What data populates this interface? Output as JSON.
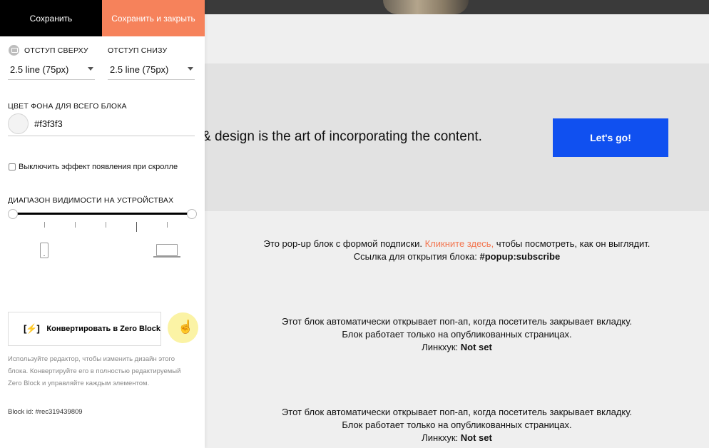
{
  "toolbar": {
    "save_label": "Сохранить",
    "save_close_label": "Сохранить и закрыть"
  },
  "settings": {
    "padding_top": {
      "label": "ОТСТУП СВЕРХУ",
      "value": "2.5 line (75px)",
      "icon": "monitor-icon"
    },
    "padding_bottom": {
      "label": "ОТСТУП СНИЗУ",
      "value": "2.5 line (75px)"
    },
    "bg_color": {
      "label": "ЦВЕТ ФОНА ДЛЯ ВСЕГО БЛОКА",
      "value": "#f3f3f3",
      "swatch": "#f3f3f3"
    },
    "disable_scroll_effect": {
      "label": "Выключить эффект появления при скролле",
      "checked": false
    },
    "visibility": {
      "label": "ДИАПАЗОН ВИДИМОСТИ НА УСТРОЙСТВАХ",
      "min_icon": "phone-icon",
      "max_icon": "laptop-icon"
    },
    "zero_block": {
      "button_label": "Конвертировать в Zero Block",
      "icon": "[⚡]",
      "help": "Используйте редактор, чтобы изменить дизайн этого блока. Конвертируйте его в полностью редактируемый Zero Block и управляйте каждым элементом."
    },
    "block_id": "Block id: #rec319439809"
  },
  "canvas": {
    "cta_text": "& design is the art of incorporating the content.",
    "cta_button": "Let's go!",
    "popup_info": {
      "line1_pre": "Это pop-up блок с формой подписки. ",
      "line1_link": "Кликните здесь,",
      "line1_post": " чтобы посмотреть, как он выглядит.",
      "line2_pre": "Ссылка для открытия блока: ",
      "line2_bold": "#popup:subscribe"
    },
    "exit_info_1": {
      "line1": "Этот блок автоматически открывает поп-ап, когда посетитель закрывает вкладку.",
      "line2": "Блок работает только на опубликованных страницах.",
      "line3_pre": "Линкхук: ",
      "line3_bold": "Not set"
    },
    "exit_info_2": {
      "line1": "Этот блок автоматически открывает поп-ап, когда посетитель закрывает вкладку.",
      "line2": "Блок работает только на опубликованных страницах.",
      "line3_pre": "Линкхук: ",
      "line3_bold": "Not set"
    }
  },
  "colors": {
    "accent": "#f6825b",
    "cta_blue": "#1050f0",
    "panel_bg": "#ffffff",
    "canvas_bg": "#efefef"
  }
}
